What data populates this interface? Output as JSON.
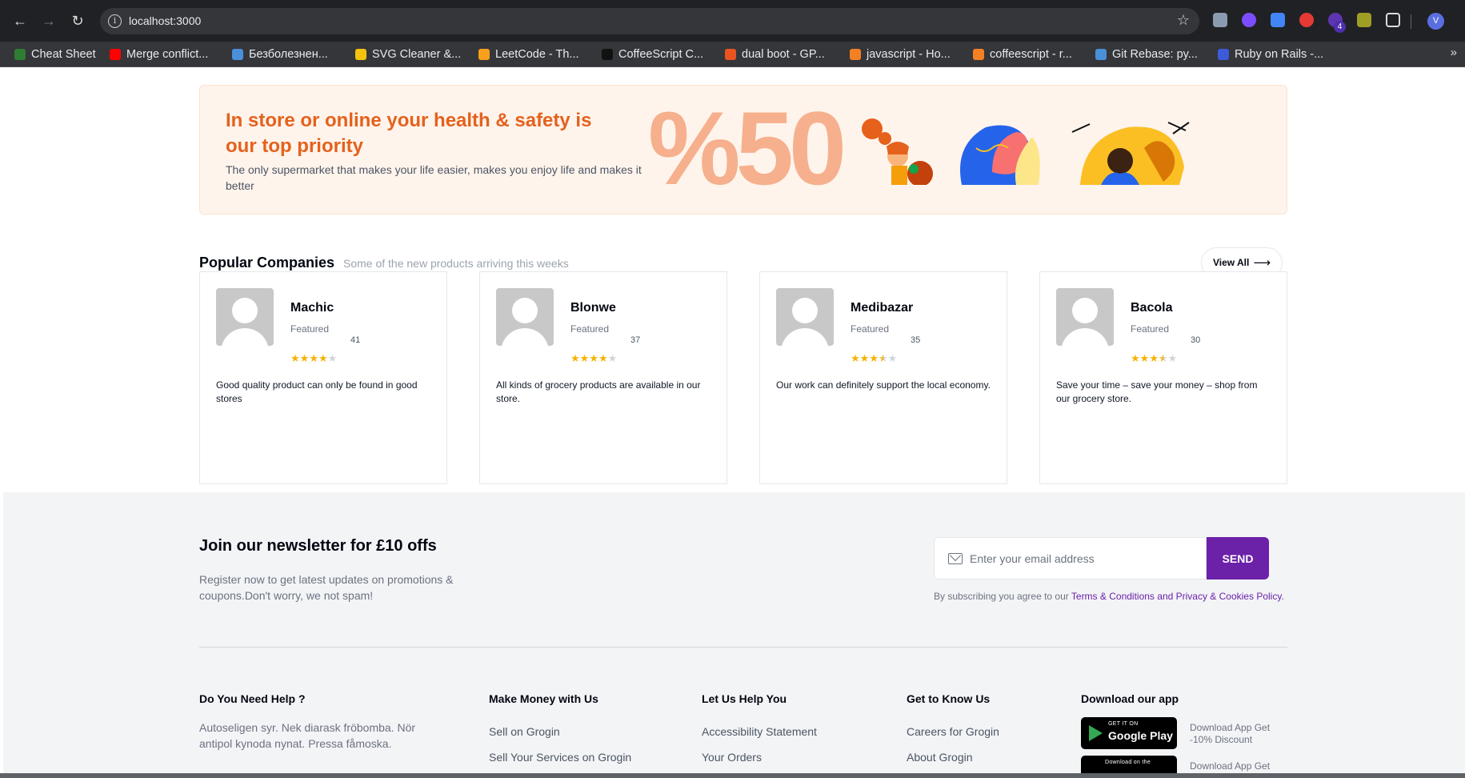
{
  "browser": {
    "url": "localhost:3000",
    "extension_badge": "4",
    "profile_initial": "V",
    "bookmarks": [
      {
        "label": "Cheat Sheet",
        "icon": "shield-icon",
        "color": "#2e7d32"
      },
      {
        "label": "Merge conflict...",
        "icon": "youtube-icon",
        "color": "#ff0000"
      },
      {
        "label": "Безболезнен...",
        "icon": "star-icon",
        "color": "#4a90d9"
      },
      {
        "label": "SVG Cleaner &...",
        "icon": "warning-icon",
        "color": "#f4c20d"
      },
      {
        "label": "LeetCode - Th...",
        "icon": "leetcode-icon",
        "color": "#f89f1b"
      },
      {
        "label": "CoffeeScript C...",
        "icon": "book-icon",
        "color": "#111111"
      },
      {
        "label": "dual boot - GP...",
        "icon": "askubuntu-icon",
        "color": "#e95420"
      },
      {
        "label": "javascript - Ho...",
        "icon": "stackoverflow-icon",
        "color": "#f48024"
      },
      {
        "label": "coffeescript - r...",
        "icon": "stackoverflow-icon",
        "color": "#f48024"
      },
      {
        "label": "Git Rebase: py...",
        "icon": "star-icon",
        "color": "#4a90d9"
      },
      {
        "label": "Ruby on Rails -...",
        "icon": "cl-icon",
        "color": "#3b5bdb"
      }
    ]
  },
  "banner": {
    "title": "In store or online your health & safety is our top priority",
    "text": "The only supermarket that makes your life easier, makes you enjoy life and makes it better",
    "percent": "%50"
  },
  "companies": {
    "title": "Popular Companies",
    "subtitle": "Some of the new products arriving this weeks",
    "view_all": "View All",
    "items": [
      {
        "name": "Machic",
        "tag": "Featured",
        "count": "41",
        "rating": 4,
        "desc": "Good quality product can only be found in good stores"
      },
      {
        "name": "Blonwe",
        "tag": "Featured",
        "count": "37",
        "rating": 4,
        "desc": "All kinds of grocery products are available in our store."
      },
      {
        "name": "Medibazar",
        "tag": "Featured",
        "count": "35",
        "rating": 3.5,
        "desc": "Our work can definitely support the local economy."
      },
      {
        "name": "Bacola",
        "tag": "Featured",
        "count": "30",
        "rating": 3.5,
        "desc": "Save your time – save your money – shop from our grocery store."
      }
    ]
  },
  "newsletter": {
    "title": "Join our newsletter for £10 offs",
    "text": "Register now to get latest updates on promotions & coupons.Don't worry, we not spam!",
    "placeholder": "Enter your email address",
    "send": "SEND",
    "terms_prefix": "By subscribing you agree to our",
    "terms_link": "Terms & Conditions and Privacy & Cookies Policy."
  },
  "footer": {
    "help": {
      "title": "Do You Need Help ?",
      "text": "Autoseligen syr. Nek diarask fröbomba. Nör antipol kynoda nynat. Pressa fåmoska."
    },
    "money": {
      "title": "Make Money with Us",
      "links": [
        "Sell on Grogin",
        "Sell Your Services on Grogin"
      ]
    },
    "helpyou": {
      "title": "Let Us Help You",
      "links": [
        "Accessibility Statement",
        "Your Orders"
      ]
    },
    "know": {
      "title": "Get to Know Us",
      "links": [
        "Careers for Grogin",
        "About Grogin"
      ]
    },
    "app": {
      "title": "Download our app",
      "google_small": "GET IT ON",
      "google_big": "Google Play",
      "apple_small": "Download on the",
      "note1": "Download App Get -10% Discount",
      "note2": "Download App Get"
    }
  }
}
